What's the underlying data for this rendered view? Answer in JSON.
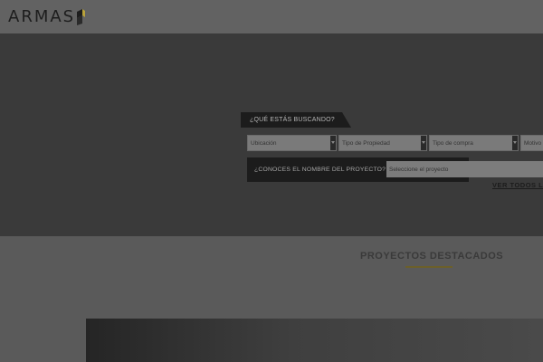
{
  "header": {
    "logo_text": "ARMAS",
    "logo_accent": "#b8a13a"
  },
  "search": {
    "tab_label": "¿QUÉ ESTÁS BUSCANDO?",
    "filters": [
      {
        "value": "Ubicación"
      },
      {
        "value": "Tipo de Propiedad"
      },
      {
        "value": "Tipo de compra"
      },
      {
        "value": "Motivo de"
      }
    ],
    "project_label": "¿CONOCES EL NOMBRE DEL PROYECTO?",
    "project_placeholder": "Seleccione el proyecto",
    "ver_todos": "VER TODOS LO"
  },
  "featured": {
    "title": "PROYECTOS DESTACADOS",
    "accent": "#6b5f2a"
  }
}
